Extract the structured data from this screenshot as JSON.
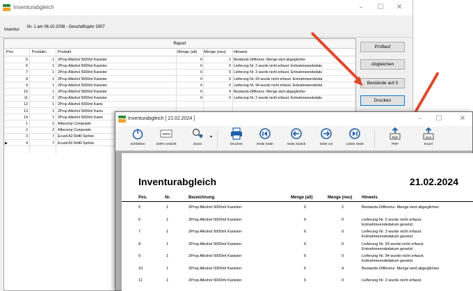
{
  "main_window": {
    "title": "Inventurabgleich",
    "controls": {
      "minimize": "–",
      "maximize": "☐",
      "close": "✕"
    },
    "inventur_label": "Inventur",
    "inventur_value": "Nr. 1 am 06.10.2008 - Geschäftsjahr 2007",
    "report_title": "Report",
    "columns": {
      "pos": "Pos.",
      "produkt_nr": "Produkt...",
      "produkt": "Produkt",
      "menge_alt": "Menge (alt)",
      "menge_neu": "Menge (neu)",
      "hinweis": "Hinweis"
    },
    "rows": [
      {
        "pos": "5",
        "nr": "1",
        "produkt": "2Prop Alkohol 5000ml Kanister",
        "alt": "6",
        "neu": "2",
        "hinweis": "Bestands-Differenz. Menge wird abgeglichen"
      },
      {
        "pos": "6",
        "nr": "1",
        "produkt": "2Prop Alkohol 5000ml Kanister",
        "alt": "6",
        "neu": "0",
        "hinweis": "Lieferung Nr. 2 wurde nicht erfasst. Entnahmeendedatu"
      },
      {
        "pos": "7",
        "nr": "1",
        "produkt": "2Prop Alkohol 5000ml Kanister",
        "alt": "6",
        "neu": "0",
        "hinweis": "Lieferung Nr. 3 wurde nicht erfasst. Entnahmeendedatu"
      },
      {
        "pos": "8",
        "nr": "1",
        "produkt": "2Prop Alkohol 5000ml Kanister",
        "alt": "6",
        "neu": "0",
        "hinweis": "Lieferung Nr. 93 wurde nicht erfasst. Entnahmeendedat"
      },
      {
        "pos": "9",
        "nr": "1",
        "produkt": "2Prop Alkohol 5000ml Kanister",
        "alt": "6",
        "neu": "0",
        "hinweis": "Lieferung Nr. 94 wurde nicht erfasst. Entnahmeendedat"
      },
      {
        "pos": "10",
        "nr": "1",
        "produkt": "2Prop Alkohol 5000ml Kanister",
        "alt": "6",
        "neu": "4",
        "hinweis": "Bestands-Differenz. Menge wird abgeglichen"
      },
      {
        "pos": "11",
        "nr": "1",
        "produkt": "2Prop Alkohol 5000ml Kanister",
        "alt": "6",
        "neu": "0",
        "hinweis": "Lieferung Nr. 2 wurde nicht erfasst. Entnahmeendedatu"
      },
      {
        "pos": "12",
        "nr": "1",
        "produkt": "2Prop Alkohol 5000ml Kanis",
        "alt": "",
        "neu": "",
        "hinweis": ""
      },
      {
        "pos": "13",
        "nr": "1",
        "produkt": "2Prop Alkohol 5000ml Kanis",
        "alt": "",
        "neu": "",
        "hinweis": ""
      },
      {
        "pos": "14",
        "nr": "1",
        "produkt": "2Prop Alkohol 5000ml Kanis",
        "alt": "",
        "neu": "",
        "hinweis": ""
      },
      {
        "pos": "1",
        "nr": "2",
        "produkt": "Alfacomp Composite",
        "alt": "",
        "neu": "",
        "hinweis": ""
      },
      {
        "pos": "2",
        "nr": "2",
        "produkt": "Alfacomp Composite",
        "alt": "",
        "neu": "",
        "hinweis": ""
      },
      {
        "pos": "3",
        "nr": "7",
        "produkt": "Ecusit A2 Refill Spritze",
        "alt": "",
        "neu": "",
        "hinweis": ""
      },
      {
        "pos": "4",
        "nr": "7",
        "produkt": "Ecusit A2 Refill Spritze",
        "alt": "",
        "neu": "",
        "hinweis": ""
      }
    ],
    "buttons": {
      "pruflauf": "Prüflauf",
      "abgleichen": "Abgleichen",
      "bestande": "Bestände auf 0",
      "drucken": "Drucken"
    }
  },
  "preview_window": {
    "title": "Inventurabgleich [ 21.02.2024 ]",
    "controls": {
      "minimize": "–",
      "maximize": "☐",
      "close": "✕"
    },
    "toolbar": [
      {
        "id": "schliessen",
        "label": "Schließen",
        "icon": "power-icon"
      },
      {
        "id": "ansicht",
        "label": "100% Ansicht",
        "icon": "zoom-100-icon",
        "badge": "100%"
      },
      {
        "id": "zoom",
        "label": "Zoom",
        "icon": "magnifier-icon"
      },
      {
        "id": "drucken",
        "label": "Drucken",
        "icon": "printer-icon"
      },
      {
        "id": "erste",
        "label": "Erste Seite",
        "icon": "first-page-icon"
      },
      {
        "id": "zurueck",
        "label": "Seite zurück",
        "icon": "prev-page-icon"
      },
      {
        "id": "vor",
        "label": "Seite vor",
        "icon": "next-page-icon"
      },
      {
        "id": "letzte",
        "label": "Letzte Seite",
        "icon": "last-page-icon"
      },
      {
        "id": "pdf",
        "label": "PDF",
        "icon": "pdf-export-icon",
        "badge": "PDF"
      },
      {
        "id": "excel",
        "label": "Excel",
        "icon": "excel-export-icon",
        "badge": "XLS"
      }
    ],
    "document": {
      "title": "Inventurabgleich",
      "date": "21.02.2024",
      "columns": {
        "pos": "Pos.",
        "nr": "Nr.",
        "bezeichnung": "Bezeichnung",
        "alt": "Menge (alt)",
        "neu": "Menge (neu)",
        "hinweis": "Hinweis"
      },
      "rows": [
        {
          "pos": "5",
          "nr": "1",
          "bez": "2Prop Alkohol 5000ml Kanister",
          "alt": "6",
          "neu": "2",
          "hinweis": "Bestands-Differenz. Menge wird abgeglichen"
        },
        {
          "pos": "6",
          "nr": "1",
          "bez": "2Prop Alkohol 5000ml Kanister",
          "alt": "6",
          "neu": "0",
          "hinweis": "Lieferung Nr. 2 wurde nicht erfasst. Entnahmeendedatum gesetzt."
        },
        {
          "pos": "7",
          "nr": "1",
          "bez": "2Prop Alkohol 5000ml Kanister",
          "alt": "6",
          "neu": "0",
          "hinweis": "Lieferung Nr. 3 wurde nicht erfasst. Entnahmeendedatum gesetzt."
        },
        {
          "pos": "8",
          "nr": "1",
          "bez": "2Prop Alkohol 5000ml Kanister",
          "alt": "6",
          "neu": "0",
          "hinweis": "Lieferung Nr. 93 wurde nicht erfasst. Entnahmeendedatum gesetzt."
        },
        {
          "pos": "9",
          "nr": "1",
          "bez": "2Prop Alkohol 5000ml Kanister",
          "alt": "6",
          "neu": "0",
          "hinweis": "Lieferung Nr. 94 wurde nicht erfasst. Entnahmeendedatum gesetzt."
        },
        {
          "pos": "10",
          "nr": "1",
          "bez": "2Prop Alkohol 5000ml Kanister",
          "alt": "6",
          "neu": "4",
          "hinweis": "Bestands-Differenz. Menge wird abgeglichen"
        },
        {
          "pos": "11",
          "nr": "1",
          "bez": "2Prop Alkohol 5000ml Kanister",
          "alt": "6",
          "neu": "0",
          "hinweis": "Lieferung Nr. 2 wurde nicht erfasst."
        }
      ]
    }
  },
  "colors": {
    "accent_blue": "#0078d7",
    "annotation_red": "#e0482b",
    "icon_blue": "#1f5fa8",
    "preview_bg": "#ababab"
  }
}
